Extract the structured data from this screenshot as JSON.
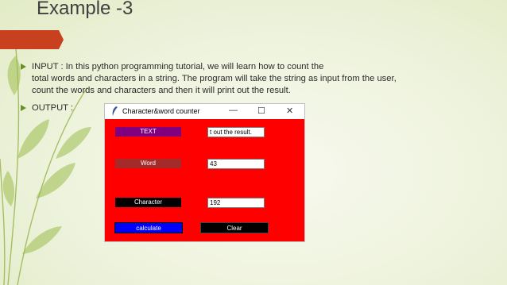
{
  "slide": {
    "title": "Example -3",
    "bullets": [
      {
        "lines": [
          "INPUT : In this python programming tutorial, we will learn how to count the",
          "total words and characters in a string. The program will take the string as input from the user,",
          "count the words and characters and then it will print out the result."
        ]
      },
      {
        "text": "OUTPUT :"
      }
    ]
  },
  "window": {
    "title": "Character&word counter",
    "controls": {
      "minimize": "—",
      "maximize": "☐",
      "close": "✕"
    },
    "labels": {
      "text": "TEXT",
      "word": "Word",
      "character": "Character"
    },
    "entries": {
      "text_value": "t out the result.",
      "word_value": "43",
      "character_value": "192"
    },
    "buttons": {
      "calculate": "calculate",
      "clear": "Clear"
    },
    "colors": {
      "background": "#ff0000",
      "text_label": "#800080",
      "word_label": "#a52a2a",
      "character_label": "#000000",
      "calculate_button": "#0000ff",
      "clear_button": "#000000"
    }
  }
}
